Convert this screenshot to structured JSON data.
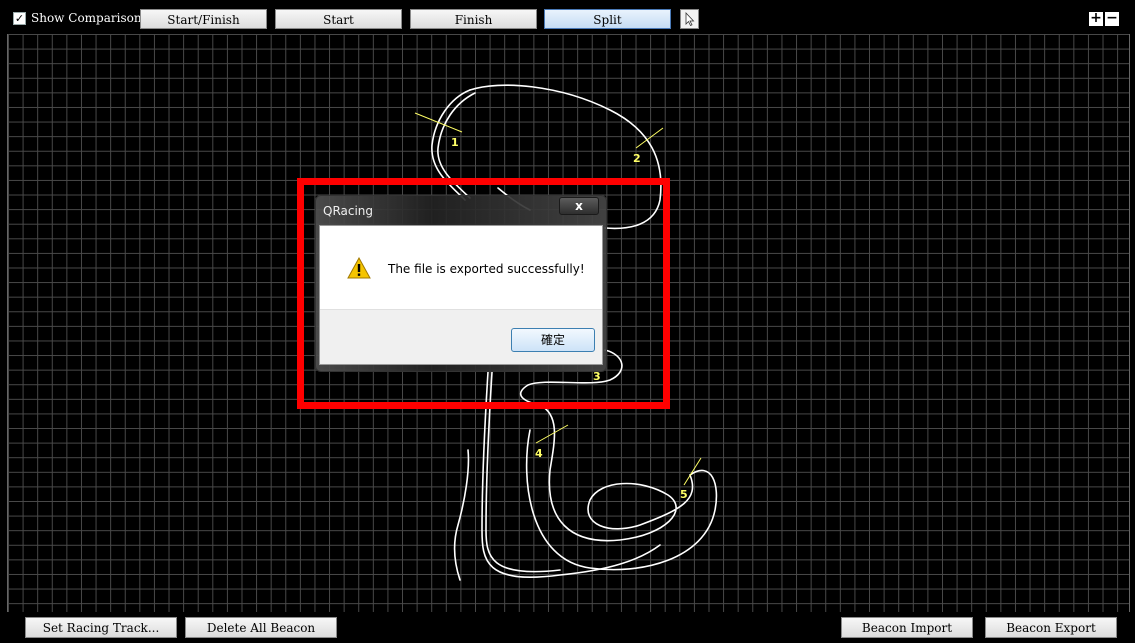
{
  "toolbar": {
    "show_comparison_label": "Show Comparison",
    "show_comparison_checked": true,
    "buttons": [
      "Start/Finish",
      "Start",
      "Finish",
      "Split"
    ],
    "active_button": "Split",
    "zoom_in": "+",
    "zoom_out": "−"
  },
  "track": {
    "line_color": "#ffffff",
    "beacon_color": "#ffff66",
    "beacons": [
      "1",
      "2",
      "3",
      "4",
      "5"
    ]
  },
  "bottom": {
    "left_buttons": [
      "Set Racing Track...",
      "Delete All Beacon"
    ],
    "right_buttons": [
      "Beacon Import",
      "Beacon Export"
    ]
  },
  "dialog": {
    "title": "QRacing",
    "close": "x",
    "message": "The file is exported successfully!",
    "ok_label": "確定",
    "icon": "warning-icon"
  },
  "highlight_color": "#ff0000"
}
